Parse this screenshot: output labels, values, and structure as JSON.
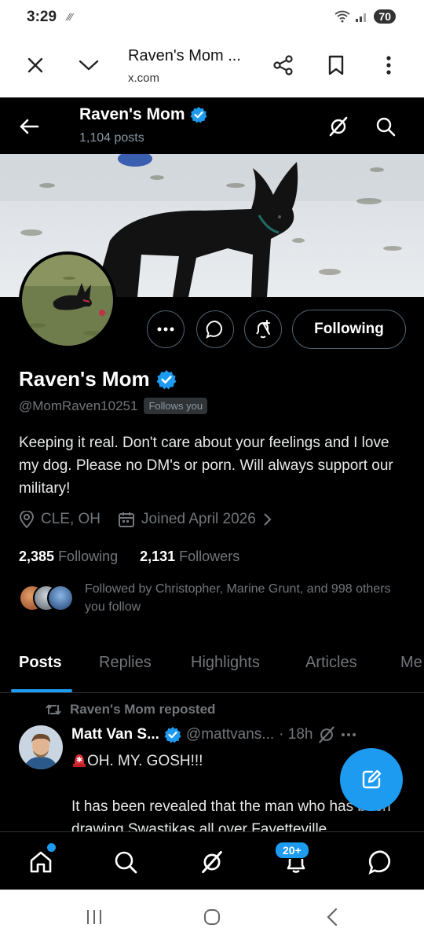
{
  "status_bar": {
    "time": "3:29",
    "battery": "70"
  },
  "browser": {
    "page_title": "Raven's Mom ...",
    "url": "x.com"
  },
  "header": {
    "name": "Raven's Mom",
    "posts_count": "1,104 posts"
  },
  "profile": {
    "name": "Raven's Mom",
    "handle": "@MomRaven10251",
    "follows_you": "Follows you",
    "bio": "Keeping it real. Don't care about your feelings and I love my dog. Please no DM's or porn. Will always support our military!",
    "location": "CLE, OH",
    "joined": "Joined April 2026",
    "following_count": "2,385",
    "following_label": "Following",
    "followers_count": "2,131",
    "followers_label": "Followers",
    "followed_by": "Followed by Christopher, Marine Grunt, and 998 others you follow",
    "following_button": "Following"
  },
  "tabs": [
    "Posts",
    "Replies",
    "Highlights",
    "Articles",
    "Me"
  ],
  "post": {
    "repost_label": "Raven's Mom reposted",
    "author": "Matt Van S...",
    "handle": "@mattvans...",
    "time": "· 18h",
    "line1": "OH. MY. GOSH!!!",
    "line2": "It has been revealed that the man who has been drawing Swastikas all over Fayetteville"
  },
  "bottom_nav": {
    "notifications_badge": "20+"
  },
  "colors": {
    "accent": "#1d9bf0",
    "background": "#000000",
    "muted": "#71767b"
  }
}
